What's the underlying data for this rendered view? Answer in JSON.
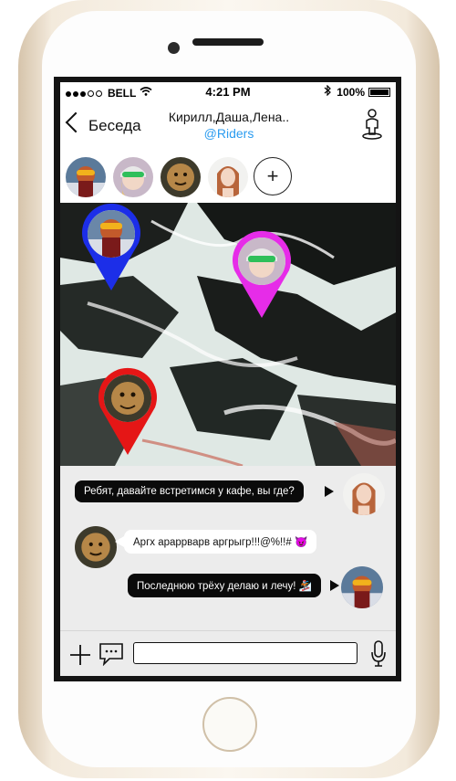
{
  "statusbar": {
    "carrier": "BELL",
    "time": "4:21 PM",
    "battery": "100%"
  },
  "navbar": {
    "back_label": "Беседа",
    "title": "Кирилл,Даша,Лена..",
    "subtitle": "@Riders"
  },
  "participants": [
    {
      "name": "snowboarder-goggles"
    },
    {
      "name": "girl-helmet"
    },
    {
      "name": "yeti"
    },
    {
      "name": "girl-redhead"
    }
  ],
  "add_participant_label": "+",
  "map": {
    "pins": [
      {
        "name": "map-pin-blue",
        "color": "#1c2ee8"
      },
      {
        "name": "map-pin-magenta",
        "color": "#e62ce8"
      },
      {
        "name": "map-pin-red",
        "color": "#e51616"
      }
    ]
  },
  "messages": [
    {
      "text": "Ребят, давайте встретимся у кафе, вы где?",
      "side": "right"
    },
    {
      "text": "Аргх араррварв аргрыгр!!!@%!!#",
      "side": "left",
      "emoji": "😈"
    },
    {
      "text": "Последнюю трёху делаю и лечу!",
      "side": "right",
      "emoji": "🏂"
    }
  ],
  "input": {
    "placeholder": ""
  },
  "icons": [
    "back-chevron-icon",
    "map-pin-icon",
    "plus-icon",
    "chat-bubble-icon",
    "microphone-icon",
    "wifi-icon",
    "bluetooth-icon",
    "battery-icon"
  ]
}
